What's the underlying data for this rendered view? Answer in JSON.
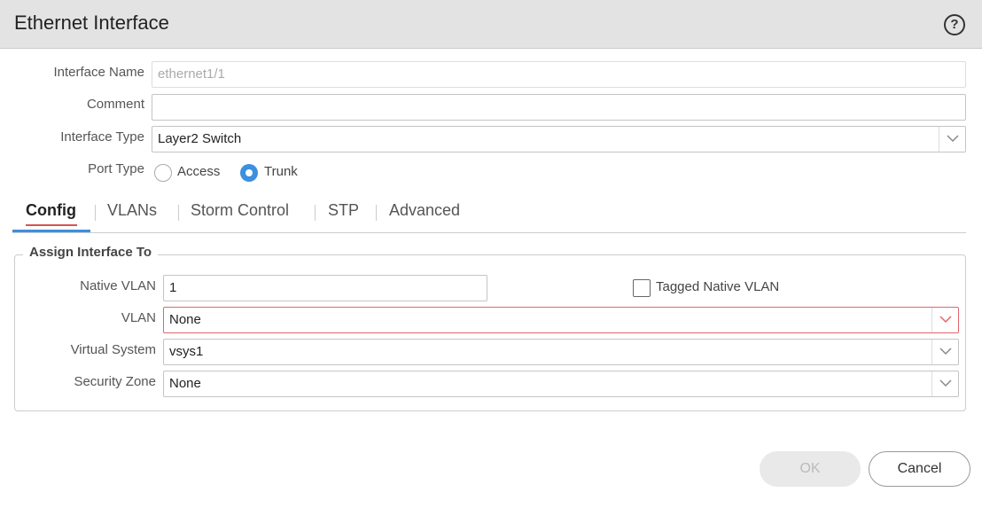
{
  "dialog": {
    "title": "Ethernet Interface",
    "help_icon": "question-circle-icon",
    "help_glyph": "?"
  },
  "form": {
    "interface_name": {
      "label": "Interface Name",
      "value": "ethernet1/1"
    },
    "comment": {
      "label": "Comment",
      "value": ""
    },
    "interface_type": {
      "label": "Interface Type",
      "value": "Layer2 Switch"
    },
    "port_type": {
      "label": "Port Type",
      "options": [
        {
          "label": "Access",
          "selected": false
        },
        {
          "label": "Trunk",
          "selected": true
        }
      ]
    }
  },
  "tabs": [
    {
      "label": "Config",
      "active": true
    },
    {
      "label": "VLANs",
      "active": false
    },
    {
      "label": "Storm Control",
      "active": false
    },
    {
      "label": "STP",
      "active": false
    },
    {
      "label": "Advanced",
      "active": false
    }
  ],
  "assign": {
    "legend": "Assign Interface To",
    "native_vlan": {
      "label": "Native VLAN",
      "value": "1"
    },
    "tagged_native_vlan": {
      "label": "Tagged Native VLAN",
      "checked": false
    },
    "vlan": {
      "label": "VLAN",
      "value": "None"
    },
    "virtual_system": {
      "label": "Virtual System",
      "value": "vsys1"
    },
    "security_zone": {
      "label": "Security Zone",
      "value": "None"
    }
  },
  "buttons": {
    "ok": "OK",
    "cancel": "Cancel"
  },
  "colors": {
    "accent": "#3d8fdf",
    "error": "#e0676b",
    "titlebar": "#e3e3e3"
  }
}
